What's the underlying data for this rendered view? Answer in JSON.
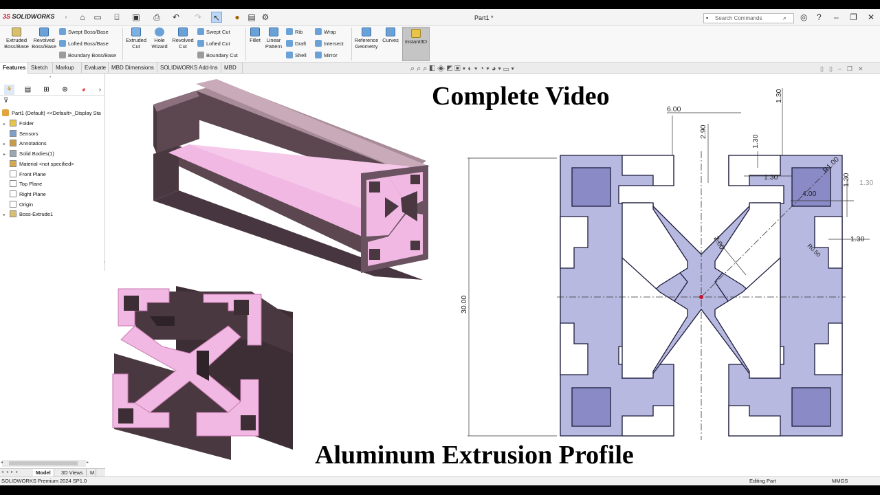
{
  "app": {
    "logo_ds": "3S",
    "logo_text": "SOLIDWORKS",
    "doc_title": "Part1 *",
    "search_placeholder": "Search Commands"
  },
  "command_manager": {
    "big_buttons": [
      {
        "label": "Extruded\nBoss/Base",
        "icon": "extrude-boss-icon"
      },
      {
        "label": "Revolved\nBoss/Base",
        "icon": "revolve-boss-icon"
      },
      {
        "label": "Extruded\nCut",
        "icon": "extrude-cut-icon"
      },
      {
        "label": "Hole\nWizard",
        "icon": "hole-wizard-icon"
      },
      {
        "label": "Revolved\nCut",
        "icon": "revolve-cut-icon"
      },
      {
        "label": "Fillet",
        "icon": "fillet-icon"
      },
      {
        "label": "Linear\nPattern",
        "icon": "linear-pattern-icon"
      },
      {
        "label": "Reference\nGeometry",
        "icon": "reference-geometry-icon"
      },
      {
        "label": "Curves",
        "icon": "curves-icon"
      },
      {
        "label": "Instant3D",
        "icon": "instant3d-icon"
      }
    ],
    "small_buttons": [
      {
        "label": "Swept Boss/Base",
        "icon": "swept-boss-icon"
      },
      {
        "label": "Lofted Boss/Base",
        "icon": "lofted-boss-icon"
      },
      {
        "label": "Boundary Boss/Base",
        "icon": "boundary-boss-icon"
      },
      {
        "label": "Swept Cut",
        "icon": "swept-cut-icon"
      },
      {
        "label": "Lofted Cut",
        "icon": "lofted-cut-icon"
      },
      {
        "label": "Boundary Cut",
        "icon": "boundary-cut-icon"
      },
      {
        "label": "Rib",
        "icon": "rib-icon"
      },
      {
        "label": "Draft",
        "icon": "draft-icon"
      },
      {
        "label": "Shell",
        "icon": "shell-icon"
      },
      {
        "label": "Wrap",
        "icon": "wrap-icon"
      },
      {
        "label": "Intersect",
        "icon": "intersect-icon"
      },
      {
        "label": "Mirror",
        "icon": "mirror-icon"
      }
    ]
  },
  "tabs": [
    "Features",
    "Sketch",
    "Markup",
    "Evaluate",
    "MBD Dimensions",
    "SOLIDWORKS Add-Ins",
    "MBD"
  ],
  "active_tab": "Features",
  "feature_tree": {
    "root": "Part1 (Default) <<Default>_Display Sta",
    "items": [
      {
        "label": "Folder",
        "expandable": true,
        "icon": "folder-icon"
      },
      {
        "label": "Sensors",
        "expandable": false,
        "icon": "sensors-icon"
      },
      {
        "label": "Annotations",
        "expandable": true,
        "icon": "annotations-icon"
      },
      {
        "label": "Solid Bodies(1)",
        "expandable": true,
        "icon": "solid-bodies-icon"
      },
      {
        "label": "Material <not specified>",
        "expandable": false,
        "icon": "material-icon"
      },
      {
        "label": "Front Plane",
        "expandable": false,
        "icon": "plane-icon"
      },
      {
        "label": "Top Plane",
        "expandable": false,
        "icon": "plane-icon"
      },
      {
        "label": "Right Plane",
        "expandable": false,
        "icon": "plane-icon"
      },
      {
        "label": "Origin",
        "expandable": false,
        "icon": "origin-icon"
      },
      {
        "label": "Boss-Extrude1",
        "expandable": true,
        "icon": "boss-extrude-icon"
      }
    ]
  },
  "bottom_tabs": [
    "Model",
    "3D Views",
    "M"
  ],
  "status": {
    "version": "SOLIDWORKS Premium 2024 SP1.0",
    "mode": "Editing Part",
    "units": "MMGS"
  },
  "overlay": {
    "title_top": "Complete Video",
    "title_bottom": "Aluminum Extrusion Profile"
  },
  "sketch_dimensions": {
    "width_top": "6.00",
    "d290": "2.90",
    "d130_top": "1.30",
    "d130_a": "1.30",
    "d130_b": "1.30",
    "d130_c": "1.30",
    "d130_right": "1.30",
    "d130_far": "1.30",
    "radius_r100": "R1.00",
    "d400": "4.00",
    "d200": "2.00",
    "r050": "R0.50",
    "height": "30.00"
  },
  "colors": {
    "profile_fill": "#b8b9e0",
    "profile_dark": "#8a8bc6",
    "extrusion_side": "#5c4750",
    "extrusion_face": "#f0b8e2",
    "accent_red": "#c8102e"
  }
}
